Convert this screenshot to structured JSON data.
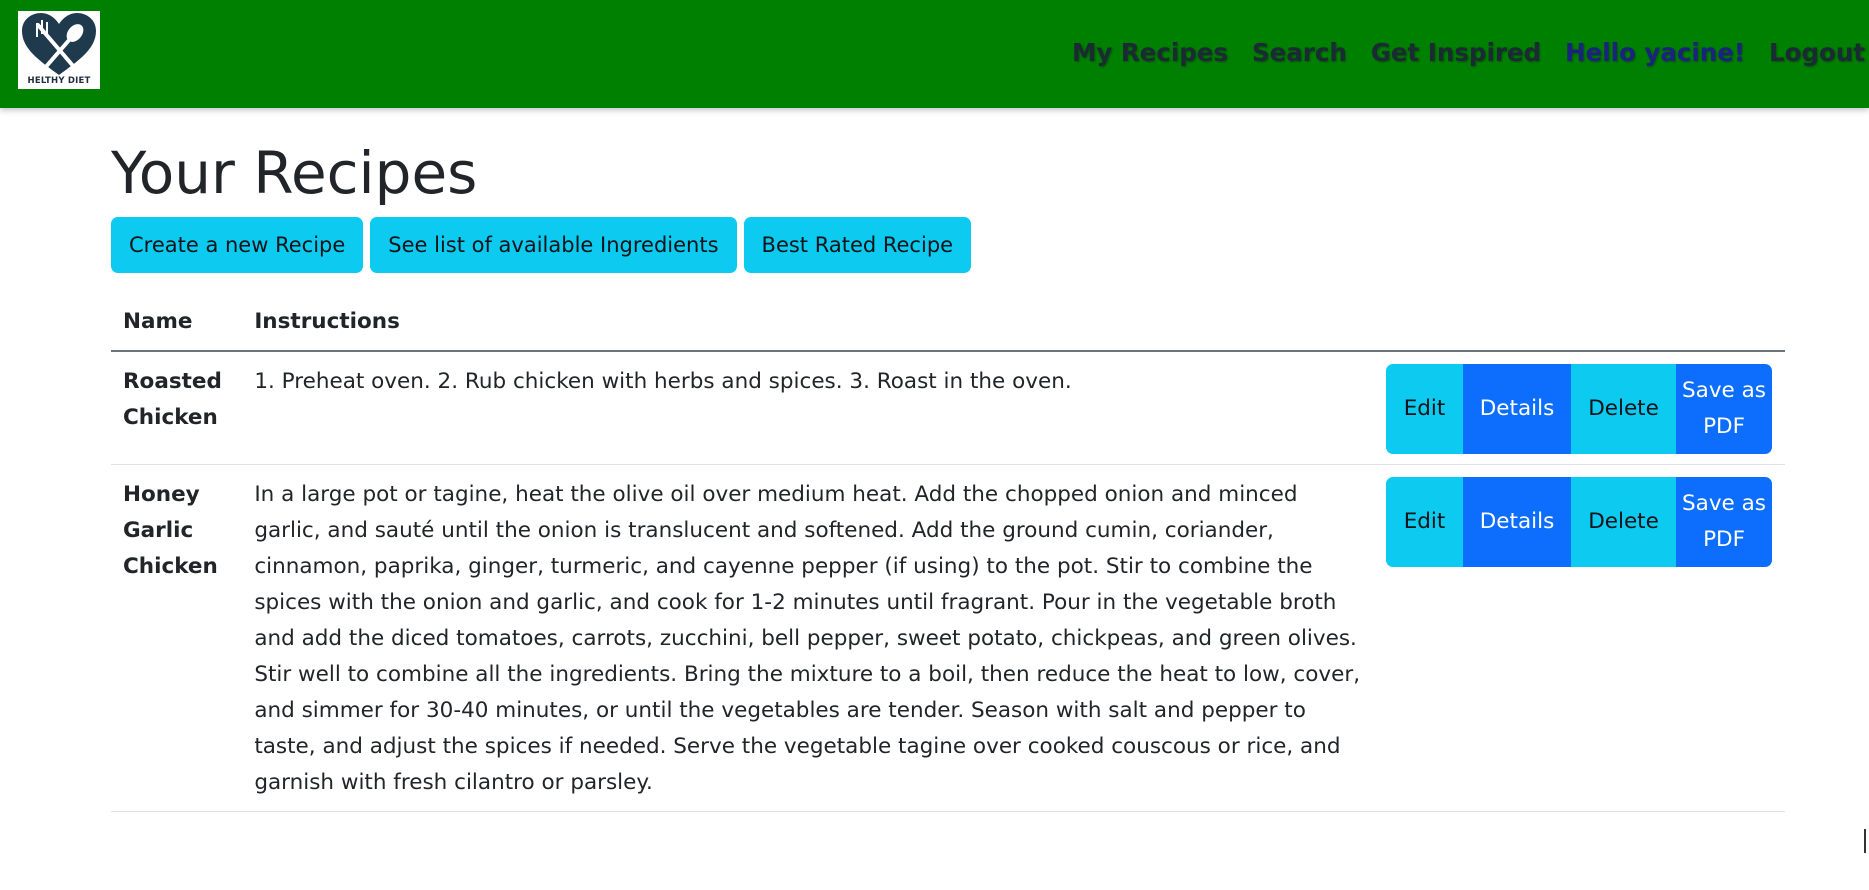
{
  "brand": {
    "logo_text": "HELTHY DIET"
  },
  "nav": {
    "my_recipes": "My Recipes",
    "search": "Search",
    "get_inspired": "Get Inspired",
    "greeting": "Hello yacine!",
    "logout": "Logout"
  },
  "page": {
    "title": "Your Recipes"
  },
  "actions": {
    "create": "Create a new Recipe",
    "ingredients": "See list of available Ingredients",
    "best_rated": "Best Rated Recipe"
  },
  "table": {
    "headers": {
      "name": "Name",
      "instructions": "Instructions"
    },
    "row_buttons": {
      "edit": "Edit",
      "details": "Details",
      "delete": "Delete",
      "save_pdf": "Save as PDF"
    },
    "rows": [
      {
        "name": "Roasted Chicken",
        "instructions": "1. Preheat oven. 2. Rub chicken with herbs and spices. 3. Roast in the oven."
      },
      {
        "name": "Honey Garlic Chicken",
        "instructions": "In a large pot or tagine, heat the olive oil over medium heat. Add the chopped onion and minced garlic, and sauté until the onion is translucent and softened. Add the ground cumin, coriander, cinnamon, paprika, ginger, turmeric, and cayenne pepper (if using) to the pot. Stir to combine the spices with the onion and garlic, and cook for 1-2 minutes until fragrant. Pour in the vegetable broth and add the diced tomatoes, carrots, zucchini, bell pepper, sweet potato, chickpeas, and green olives. Stir well to combine all the ingredients. Bring the mixture to a boil, then reduce the heat to low, cover, and simmer for 30-40 minutes, or until the vegetables are tender. Season with salt and pepper to taste, and adjust the spices if needed. Serve the vegetable tagine over cooked couscous or rice, and garnish with fresh cilantro or parsley."
      }
    ]
  },
  "colors": {
    "navbar": "#008000",
    "info": "#0dcaf0",
    "primary": "#0d6efd",
    "nav_user": "#1a237e"
  }
}
